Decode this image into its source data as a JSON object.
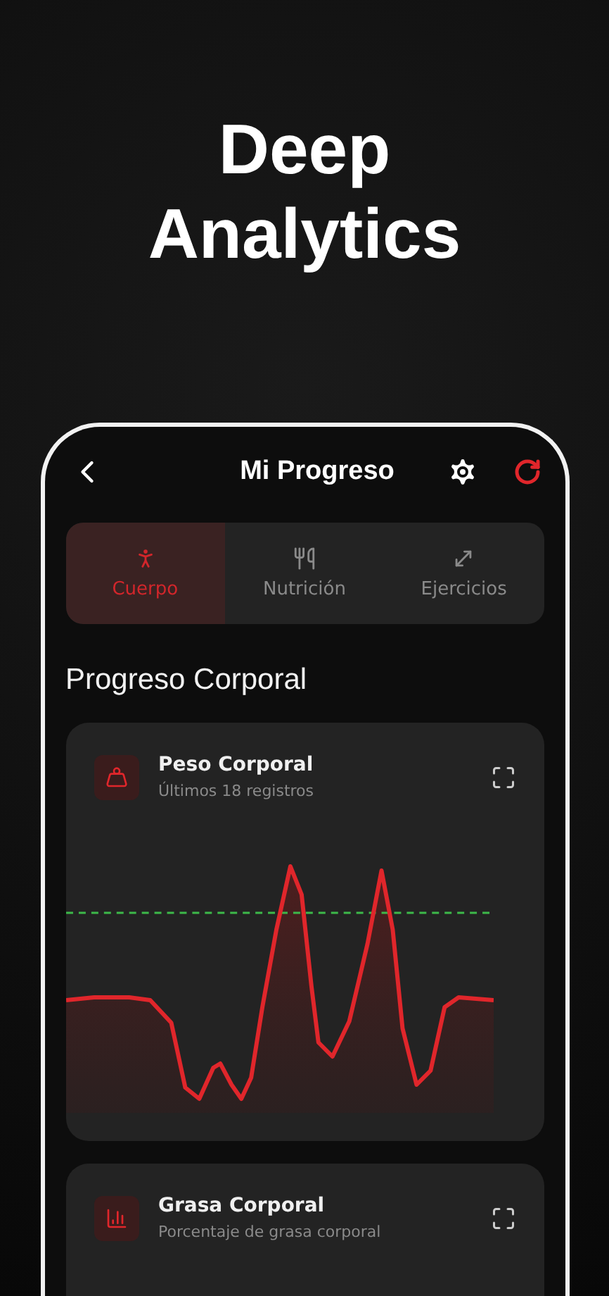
{
  "headline": [
    "Deep",
    "Analytics"
  ],
  "header": {
    "title": "Mi Progreso"
  },
  "tabs": [
    {
      "label": "Cuerpo",
      "kind": "body",
      "selected": true
    },
    {
      "label": "Nutrición",
      "kind": "food",
      "selected": false
    },
    {
      "label": "Ejercicios",
      "kind": "exercise",
      "selected": false
    }
  ],
  "section_title": "Progreso Corporal",
  "cards": [
    {
      "title": "Peso Corporal",
      "subtitle": "Últimos 18 registros",
      "kind": "weight"
    },
    {
      "title": "Grasa Corporal",
      "subtitle": "Porcentaje de grasa corporal",
      "kind": "fat"
    }
  ]
}
